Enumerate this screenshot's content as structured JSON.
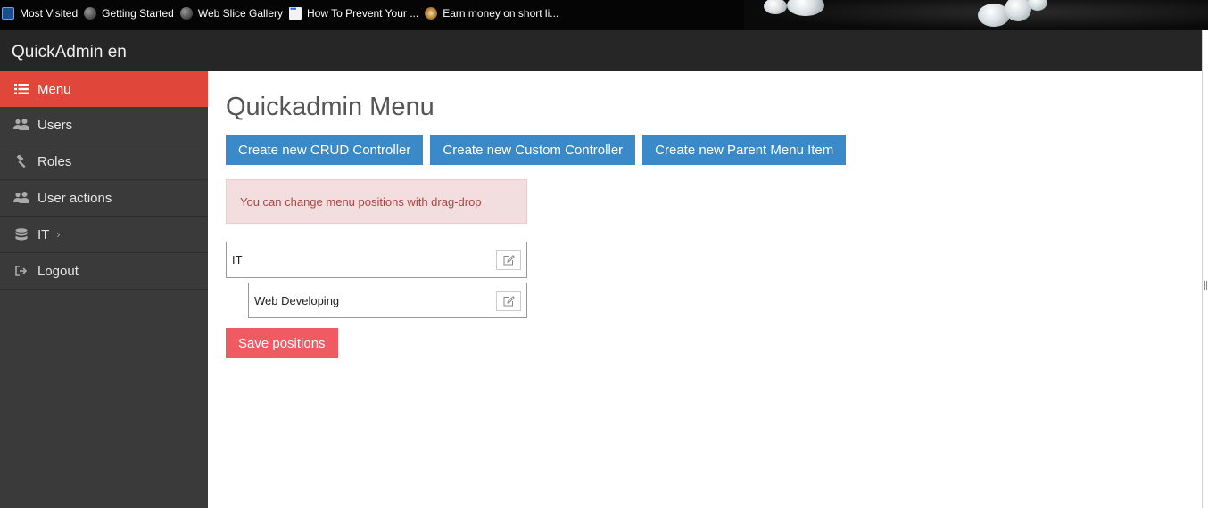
{
  "bookmarks": [
    {
      "label": "Most Visited",
      "icon": "search-icon"
    },
    {
      "label": "Getting Started",
      "icon": "globe-icon"
    },
    {
      "label": "Web Slice Gallery",
      "icon": "globe-icon"
    },
    {
      "label": "How To Prevent Your ...",
      "icon": "dots-icon"
    },
    {
      "label": "Earn money on short li...",
      "icon": "coin-icon"
    }
  ],
  "app": {
    "brand": "QuickAdmin en"
  },
  "sidebar": {
    "items": [
      {
        "label": "Menu",
        "icon": "list-icon",
        "active": true
      },
      {
        "label": "Users",
        "icon": "users-icon"
      },
      {
        "label": "Roles",
        "icon": "gavel-icon"
      },
      {
        "label": "User actions",
        "icon": "users-icon"
      },
      {
        "label": "IT",
        "icon": "database-icon",
        "has_children": true
      },
      {
        "label": "Logout",
        "icon": "sign-out-icon"
      }
    ]
  },
  "main": {
    "title": "Quickadmin Menu",
    "buttons": {
      "crud": "Create new CRUD Controller",
      "custom": "Create new Custom Controller",
      "parent": "Create new Parent Menu Item"
    },
    "alert": "You can change menu positions with drag-drop",
    "menu_items": [
      {
        "label": "IT"
      },
      {
        "label": "Web Developing"
      }
    ],
    "save_label": "Save positions"
  },
  "colors": {
    "sidebar_active": "#e0473a",
    "primary_button": "#3a89c9",
    "danger_button": "#f05a63",
    "alert_bg": "#f2dede",
    "alert_text": "#a94442"
  }
}
